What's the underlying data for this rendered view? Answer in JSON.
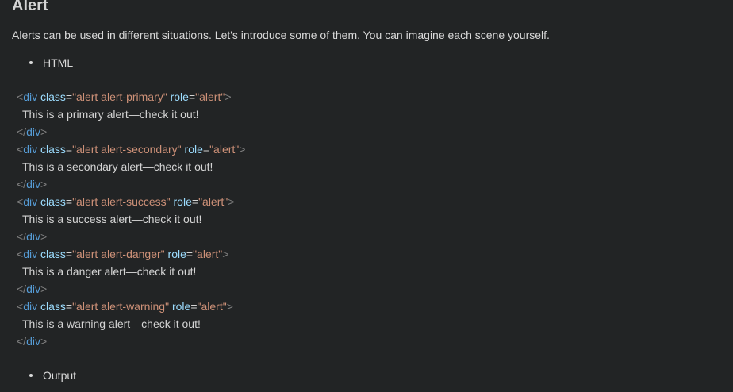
{
  "section": {
    "title": "Alert",
    "intro": "Alerts can be used in different situations. Let's introduce some of them. You can imagine each scene yourself."
  },
  "bullets": {
    "html": "HTML",
    "output": "Output"
  },
  "code_block": {
    "tag_name": "div",
    "attr_class": "class",
    "attr_role": "role",
    "role_value": "\"alert\"",
    "alerts": [
      {
        "class_value": "\"alert alert-primary\"",
        "text": "This is a primary alert—check it out!"
      },
      {
        "class_value": "\"alert alert-secondary\"",
        "text": "This is a secondary alert—check it out!"
      },
      {
        "class_value": "\"alert alert-success\"",
        "text": "This is a success alert—check it out!"
      },
      {
        "class_value": "\"alert alert-danger\"",
        "text": "This is a danger alert—check it out!"
      },
      {
        "class_value": "\"alert alert-warning\"",
        "text": "This is a warning alert—check it out!"
      }
    ]
  },
  "colors": {
    "background": "#222425",
    "text": "#d9d9d9",
    "tag": "#569cd6",
    "attribute": "#9cdcfe",
    "string": "#ce9178"
  }
}
